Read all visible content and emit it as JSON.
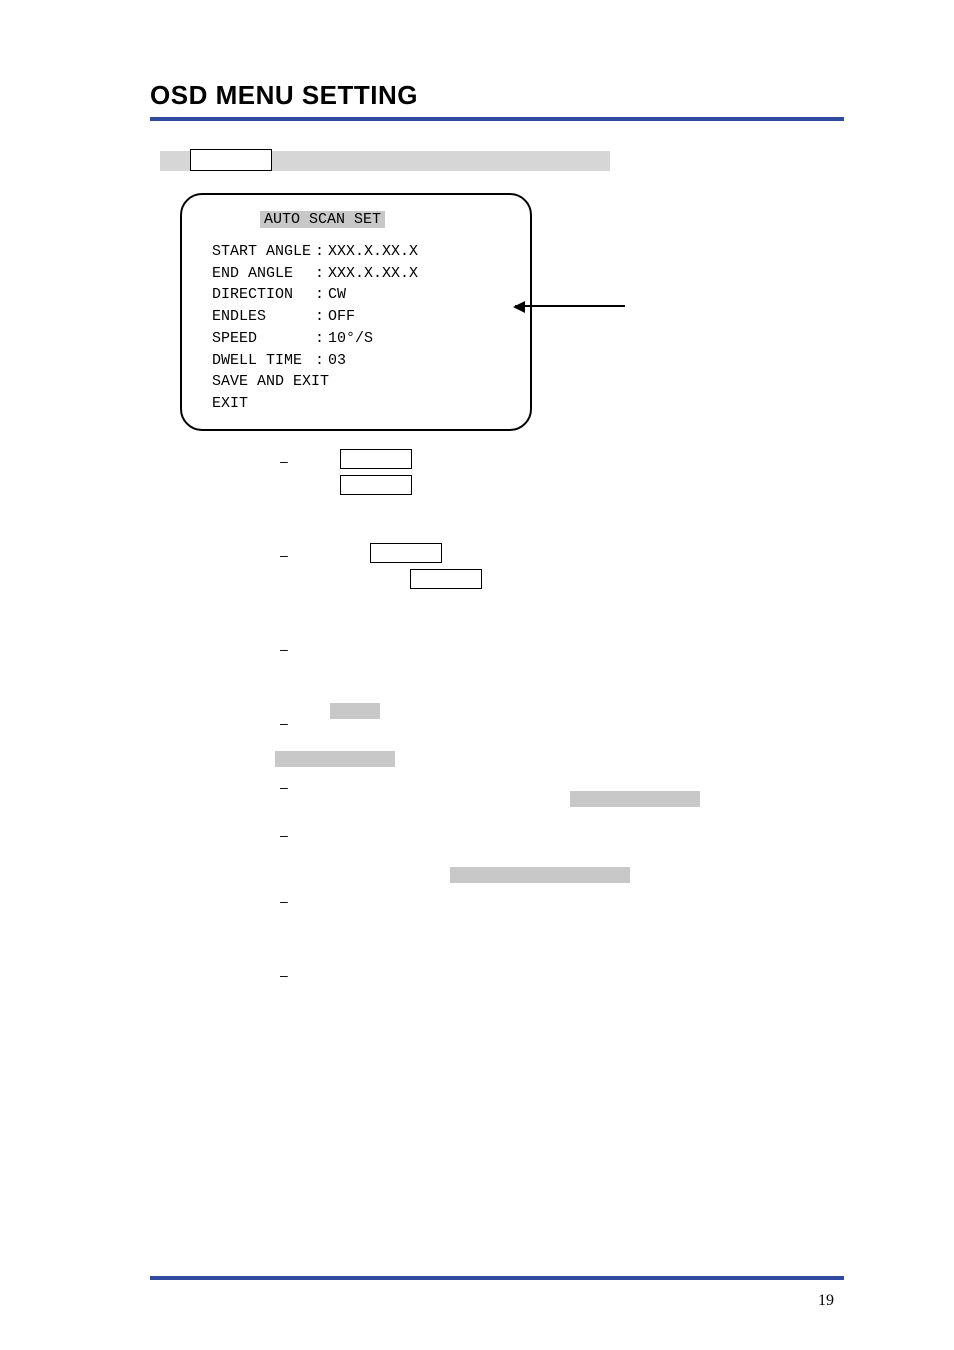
{
  "title": "OSD MENU SETTING",
  "osd": {
    "header": "AUTO SCAN SET",
    "rows": [
      {
        "label": "START ANGLE",
        "value": "XXX.X.XX.X"
      },
      {
        "label": "END ANGLE",
        "value": "XXX.X.XX.X"
      },
      {
        "label": "DIRECTION",
        "value": "CW"
      },
      {
        "label": "ENDLES",
        "value": "OFF"
      },
      {
        "label": "SPEED",
        "value": "10°/S"
      },
      {
        "label": "DWELL TIME",
        "value": "03"
      },
      {
        "label": "SAVE AND EXIT",
        "value": ""
      },
      {
        "label": "EXIT",
        "value": ""
      }
    ]
  },
  "bullets": [
    "–",
    "–",
    "–",
    "–",
    "–",
    "–",
    "–",
    "–"
  ],
  "page_number": "19"
}
